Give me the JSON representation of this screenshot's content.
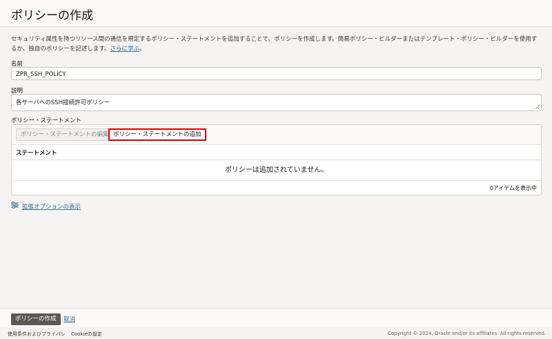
{
  "header": {
    "title": "ポリシーの作成"
  },
  "intro": {
    "text": "セキュリティ属性を持つリソース間の通信を規定するポリシー・ステートメントを追加することで、ポリシーを作成します。簡易ポリシー・ビルダーまたはテンプレート・ポリシー・ビルダーを使用するか、独自のポリシーを記述します。",
    "link": "さらに学ぶ",
    "period": "。"
  },
  "form": {
    "name_label": "名前",
    "name_value": "ZPR_SSH_POLICY",
    "desc_label": "説明",
    "desc_value": "各サーバへのSSH接続許可ポリシー"
  },
  "statements": {
    "section_label": "ポリシー・ステートメント",
    "edit_button": "ポリシー・ステートメントの編集",
    "add_button": "ポリシー・ステートメントの追加",
    "column_header": "ステートメント",
    "empty_message": "ポリシーは追加されていません。",
    "item_count": "0アイテムを表示中"
  },
  "advanced": {
    "link": "拡張オプションの表示",
    "icon": "sliders-icon"
  },
  "footer": {
    "create_button": "ポリシーの作成",
    "cancel_link": "取消"
  },
  "legal": {
    "terms": "使用条件およびプライバシ",
    "cookies": "Cookieの設定",
    "copyright": "Copyright © 2024, Oracle and/or its affiliates. All rights reserved."
  },
  "colors": {
    "accent_red": "#d40000",
    "link": "#2f6e8f",
    "primary_button": "#5f5852"
  }
}
